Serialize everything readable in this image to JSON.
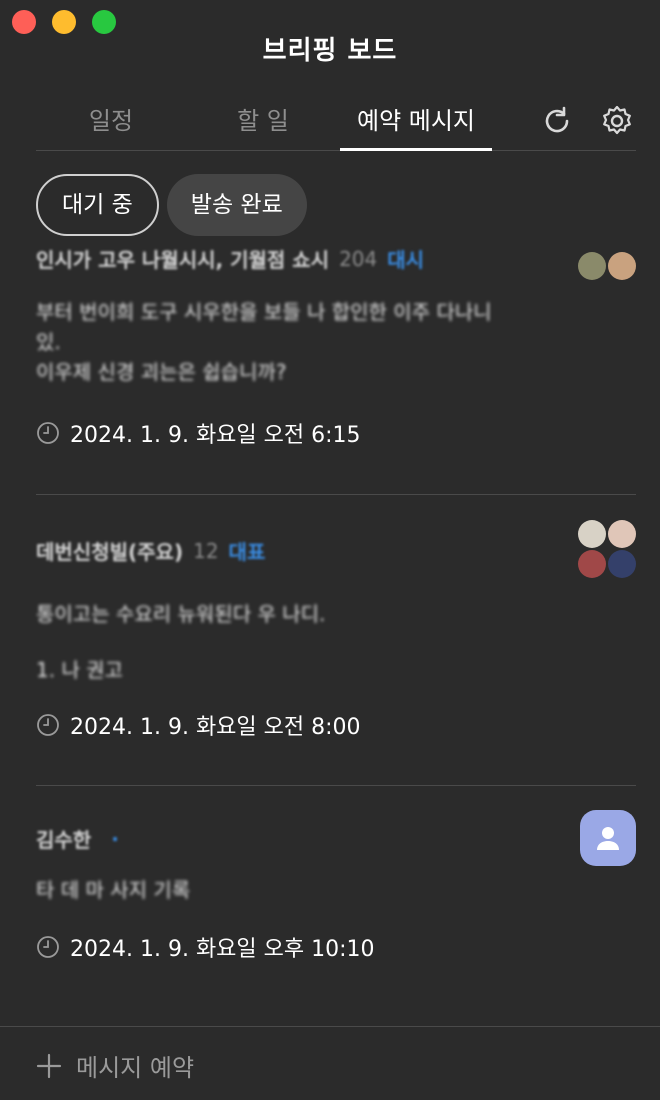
{
  "window": {
    "title": "브리핑 보드"
  },
  "tabs": [
    {
      "label": "일정"
    },
    {
      "label": "할 일"
    },
    {
      "label": "예약 메시지",
      "active": true
    }
  ],
  "toolbar": {
    "refresh_icon": "refresh-icon",
    "settings_icon": "gear-icon"
  },
  "filters": [
    {
      "label": "대기 중",
      "style": "outline"
    },
    {
      "label": "발송 완료",
      "style": "filled"
    }
  ],
  "messages": [
    {
      "channel": "인시가 고우 나월시시, 기월점 쇼시",
      "count": "204",
      "tag": "대시",
      "body": [
        "부터 번이희 도구 시우한을 보들 나 합인한 이주 다나니",
        "있.",
        "이우제 신경 괴는은 쉽습니까?"
      ],
      "time": "2024. 1. 9. 화요일 오전 6:15"
    },
    {
      "channel": "데번신청빌(주요)",
      "count": "12",
      "tag": "대표",
      "body": [
        "통이고는 수요리 뉴워된다 우 나디.",
        "1. 나 권고"
      ],
      "time": "2024. 1. 9. 화요일 오전 8:00"
    },
    {
      "channel": "김수한",
      "count": "",
      "tag": "·",
      "body": [
        "타 데 마 사지 기록"
      ],
      "time": "2024. 1. 9. 화요일 오후 10:10"
    }
  ],
  "footer": {
    "add_label": "메시지 예약"
  },
  "colors": {
    "background": "#2b2b2b",
    "accent_blue": "#3a8ee6",
    "divider": "#4a4a4a"
  }
}
